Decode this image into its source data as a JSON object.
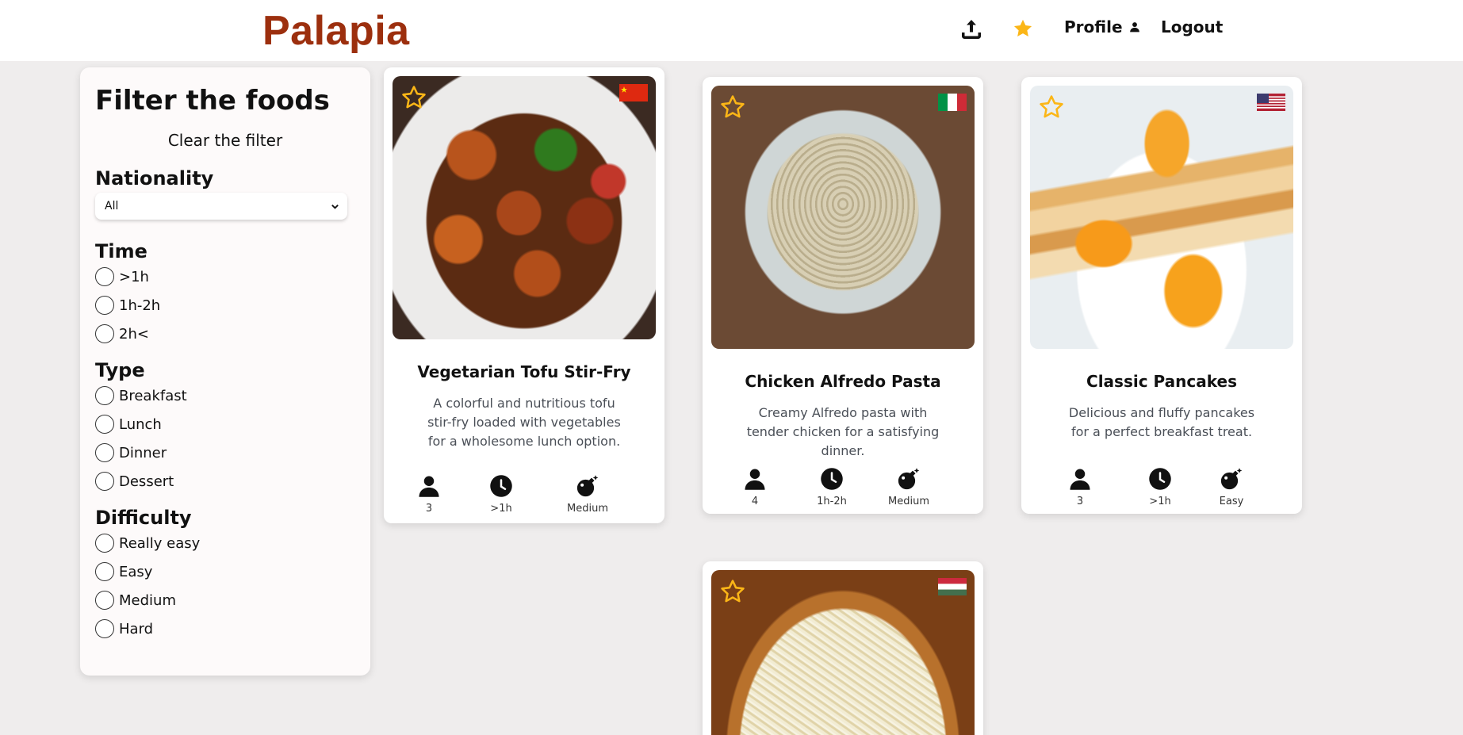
{
  "header": {
    "logo": "Palapia",
    "profile_label": "Profile",
    "logout_label": "Logout",
    "logo_color": "#9c2f0e",
    "accent_star": "#fbb617"
  },
  "sidebar": {
    "title": "Filter the foods",
    "clear_label": "Clear the filter",
    "nationality": {
      "label": "Nationality",
      "selected": "All"
    },
    "time": {
      "label": "Time",
      "options": [
        ">1h",
        "1h-2h",
        "2h<"
      ]
    },
    "type": {
      "label": "Type",
      "options": [
        "Breakfast",
        "Lunch",
        "Dinner",
        "Dessert"
      ]
    },
    "difficulty": {
      "label": "Difficulty",
      "options": [
        "Really easy",
        "Easy",
        "Medium",
        "Hard"
      ]
    }
  },
  "cards": [
    {
      "title": "Vegetarian Tofu Stir-Fry",
      "description": "A colorful and nutritious tofu stir-fry loaded with vegetables for a wholesome lunch option.",
      "servings": "3",
      "time": ">1h",
      "difficulty": "Medium",
      "flag": "china-flag-icon"
    },
    {
      "title": "Chicken Alfredo Pasta",
      "description": "Creamy Alfredo pasta with tender chicken for a satisfying dinner.",
      "servings": "4",
      "time": "1h-2h",
      "difficulty": "Medium",
      "flag": "italy-flag-icon"
    },
    {
      "title": "Classic Pancakes",
      "description": "Delicious and fluffy pancakes for a perfect breakfast treat.",
      "servings": "3",
      "time": ">1h",
      "difficulty": "Easy",
      "flag": "usa-flag-icon"
    },
    {
      "title": "",
      "description": "",
      "flag": "hungary-flag-icon"
    }
  ]
}
